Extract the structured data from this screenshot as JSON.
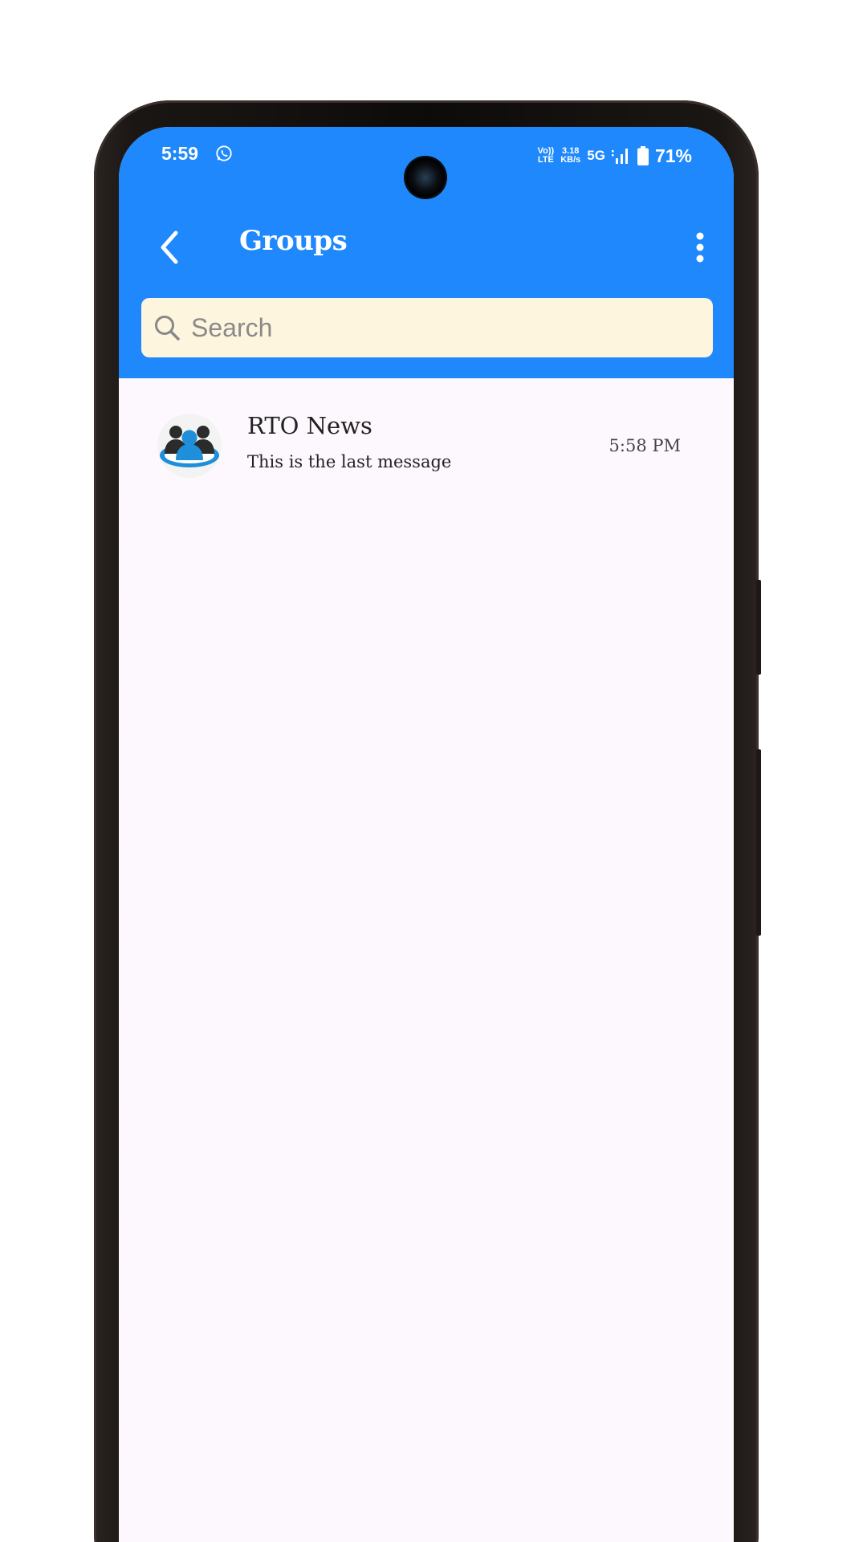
{
  "colors": {
    "header_bg": "#1e88fc",
    "search_bg": "#fdf5dd",
    "screen_bg": "#fdf8fd"
  },
  "status_bar": {
    "time": "5:59",
    "notification_icon": "whatsapp-icon",
    "volte_label_top": "Vo))",
    "volte_label_bottom": "LTE",
    "speed_value": "3.18",
    "speed_unit": "KB/s",
    "network": "5G",
    "signal_icon": "signal-icon",
    "battery_icon": "battery-icon",
    "battery_percent": "71%"
  },
  "toolbar": {
    "back_icon": "chevron-left-icon",
    "title": "Groups",
    "menu_icon": "more-vertical-icon"
  },
  "search": {
    "placeholder": "Search",
    "value": "",
    "icon": "search-icon"
  },
  "groups": [
    {
      "name": "RTO News",
      "last_message": "This is the last message",
      "time": "5:58 PM",
      "avatar_icon": "group-avatar-icon"
    }
  ]
}
